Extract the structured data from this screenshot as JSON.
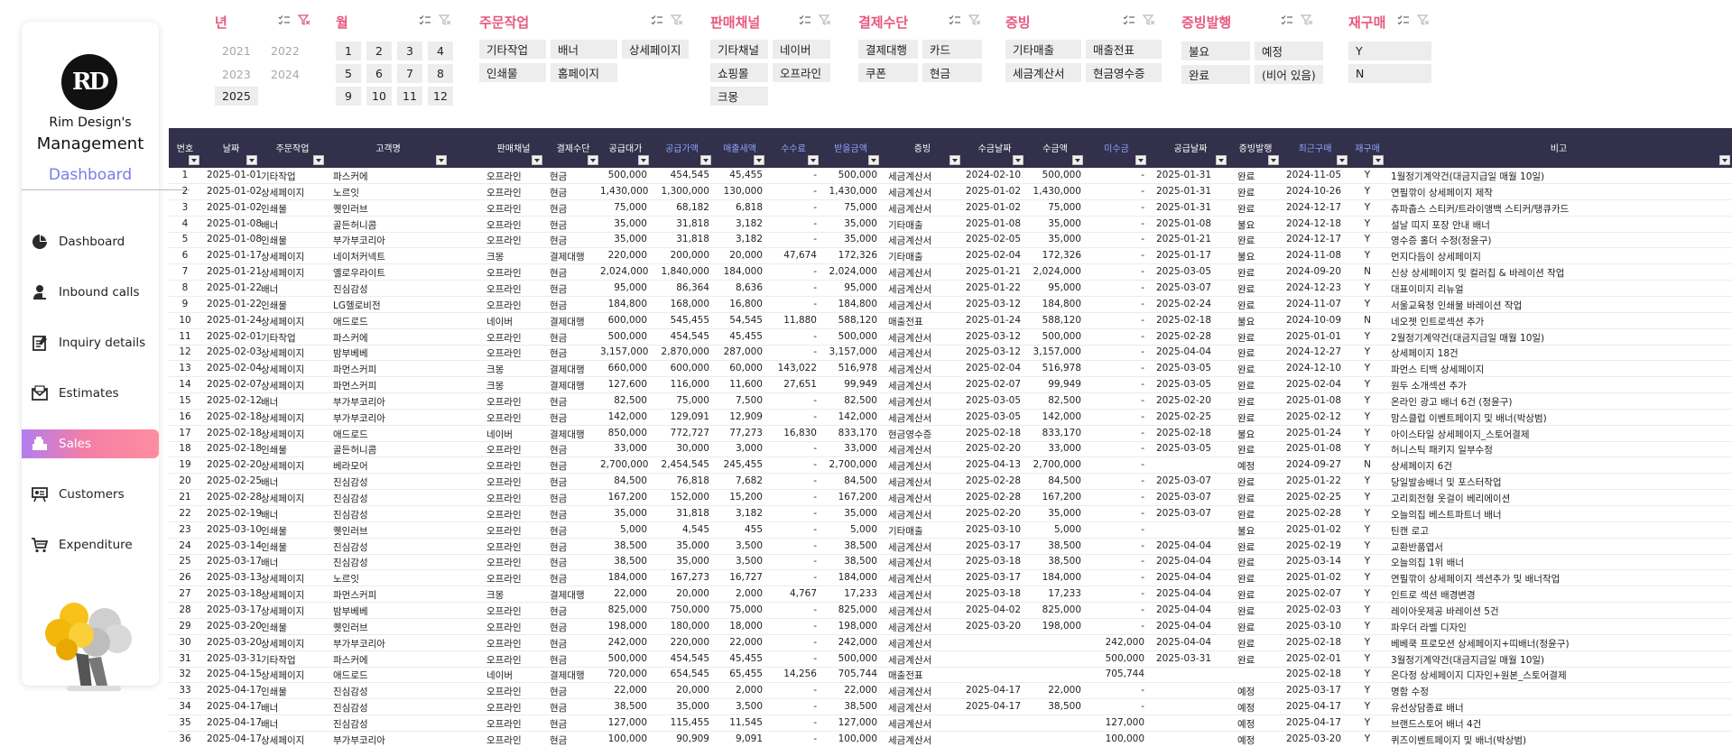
{
  "sidebar": {
    "logo_text": "RD",
    "brand_line1": "Rim Design's",
    "brand_line2": "Management",
    "brand_line3": "Dashboard",
    "nav": [
      {
        "label": "Dashboard",
        "icon": "pie-chart-icon"
      },
      {
        "label": "Inbound calls",
        "icon": "phone-person-icon"
      },
      {
        "label": "Inquiry details",
        "icon": "notepad-icon"
      },
      {
        "label": "Estimates",
        "icon": "envelope-icon"
      },
      {
        "label": "Sales",
        "icon": "cash-register-icon",
        "active": true
      },
      {
        "label": "Customers",
        "icon": "presentation-icon"
      },
      {
        "label": "Expenditure",
        "icon": "cart-icon"
      }
    ]
  },
  "slicers": {
    "year": {
      "title": "년",
      "items": [
        "2021",
        "2022",
        "2023",
        "2024",
        "2025"
      ],
      "selected": [
        "2025"
      ]
    },
    "month": {
      "title": "월",
      "items": [
        "1",
        "2",
        "3",
        "4",
        "5",
        "6",
        "7",
        "8",
        "9",
        "10",
        "11",
        "12"
      ]
    },
    "job": {
      "title": "주문작업",
      "items": [
        "기타작업",
        "배너",
        "상세페이지",
        "인쇄물",
        "홈페이지"
      ]
    },
    "channel": {
      "title": "판매채널",
      "items": [
        "기타채널",
        "네이버",
        "쇼핑몰",
        "오프라인",
        "크몽"
      ]
    },
    "payment": {
      "title": "결제수단",
      "items": [
        "결제대행",
        "카드",
        "쿠폰",
        "현금"
      ]
    },
    "evidence": {
      "title": "증빙",
      "items": [
        "기타매출",
        "매출전표",
        "세금계산서",
        "현금영수증"
      ]
    },
    "evidence_issue": {
      "title": "증빙발행",
      "items": [
        "불요",
        "예정",
        "완료",
        "(비어 있음)"
      ]
    },
    "repurchase": {
      "title": "재구매",
      "items": [
        "Y",
        "N"
      ]
    }
  },
  "table": {
    "headers": [
      "번호",
      "날짜",
      "주문작업",
      "고객명",
      "판매채널",
      "결제수단",
      "공급대가",
      "공급가액",
      "매출세액",
      "수수료",
      "받을금액",
      "증빙",
      "수금날짜",
      "수금액",
      "미수금",
      "공급날짜",
      "증빙발행",
      "최근구매",
      "재구매",
      "비고"
    ],
    "rows": [
      [
        "1",
        "2025-01-01",
        "기타작업",
        "파스커에",
        "오프라인",
        "현금",
        "500,000",
        "454,545",
        "45,455",
        "-",
        "500,000",
        "세금계산서",
        "2024-02-10",
        "500,000",
        "-",
        "2025-01-31",
        "완료",
        "2024-11-05",
        "Y",
        "1월정기계약건(대금지급일 매월 10일)"
      ],
      [
        "2",
        "2025-01-02",
        "상세페이지",
        "노르잇",
        "오프라인",
        "현금",
        "1,430,000",
        "1,300,000",
        "130,000",
        "-",
        "1,430,000",
        "세금계산서",
        "2025-01-02",
        "1,430,000",
        "-",
        "2025-01-31",
        "완료",
        "2024-10-26",
        "Y",
        "연필깎이 상세페이지 제작"
      ],
      [
        "3",
        "2025-01-02",
        "인쇄물",
        "퀫인러브",
        "오프라인",
        "현금",
        "75,000",
        "68,182",
        "6,818",
        "-",
        "75,000",
        "세금계산서",
        "2025-01-02",
        "75,000",
        "-",
        "2025-01-31",
        "완료",
        "2024-12-17",
        "Y",
        "츄파춥스 스티커/트라이앵백 스티커/탱큐카드"
      ],
      [
        "4",
        "2025-01-08",
        "배너",
        "골든허니콤",
        "오프라인",
        "현금",
        "35,000",
        "31,818",
        "3,182",
        "-",
        "35,000",
        "기타매출",
        "2025-01-08",
        "35,000",
        "-",
        "2025-01-08",
        "불요",
        "2024-12-18",
        "Y",
        "설날 띠지 포장 안내 배너"
      ],
      [
        "5",
        "2025-01-08",
        "인쇄물",
        "부가부코리아",
        "오프라인",
        "현금",
        "35,000",
        "31,818",
        "3,182",
        "-",
        "35,000",
        "세금계산서",
        "2025-02-05",
        "35,000",
        "-",
        "2025-01-21",
        "완료",
        "2024-12-17",
        "Y",
        "영수증 홀더 수정(정윤구)"
      ],
      [
        "6",
        "2025-01-17",
        "상세페이지",
        "네이처커넥트",
        "크몽",
        "결제대행",
        "220,000",
        "200,000",
        "20,000",
        "47,674",
        "172,326",
        "기타매출",
        "2025-02-04",
        "172,326",
        "-",
        "2025-01-17",
        "불요",
        "2024-11-08",
        "Y",
        "먼지다듬이 상세페이지"
      ],
      [
        "7",
        "2025-01-21",
        "상세페이지",
        "옐로우라이트",
        "오프라인",
        "현금",
        "2,024,000",
        "1,840,000",
        "184,000",
        "-",
        "2,024,000",
        "세금계산서",
        "2025-01-21",
        "2,024,000",
        "-",
        "2025-03-05",
        "완료",
        "2024-09-20",
        "N",
        "신상 상세페이지 및 컬러칩 & 바레이션 작업"
      ],
      [
        "8",
        "2025-01-22",
        "배너",
        "진심감성",
        "오프라인",
        "현금",
        "95,000",
        "86,364",
        "8,636",
        "-",
        "95,000",
        "세금계산서",
        "2025-01-22",
        "95,000",
        "-",
        "2025-03-07",
        "완료",
        "2024-12-23",
        "Y",
        "대표이미지 리뉴얼"
      ],
      [
        "9",
        "2025-01-22",
        "인쇄물",
        "LG헬로비전",
        "오프라인",
        "현금",
        "184,800",
        "168,000",
        "16,800",
        "-",
        "184,800",
        "세금계산서",
        "2025-03-12",
        "184,800",
        "-",
        "2025-02-24",
        "완료",
        "2024-11-07",
        "Y",
        "서울교육청 인쇄물 바레이션 작업"
      ],
      [
        "10",
        "2025-01-24",
        "상세페이지",
        "애드로드",
        "네이버",
        "결제대행",
        "600,000",
        "545,455",
        "54,545",
        "11,880",
        "588,120",
        "매출전표",
        "2025-01-24",
        "588,120",
        "-",
        "2025-02-18",
        "불요",
        "2024-10-09",
        "N",
        "네오젯 인트로섹션 추가"
      ],
      [
        "11",
        "2025-02-01",
        "기타작업",
        "파스커에",
        "오프라인",
        "현금",
        "500,000",
        "454,545",
        "45,455",
        "-",
        "500,000",
        "세금계산서",
        "2025-03-12",
        "500,000",
        "-",
        "2025-02-28",
        "완료",
        "2025-01-01",
        "Y",
        "2월정기계약건(대금지급일 매월 10일)"
      ],
      [
        "12",
        "2025-02-03",
        "상세페이지",
        "밤부베베",
        "오프라인",
        "현금",
        "3,157,000",
        "2,870,000",
        "287,000",
        "-",
        "3,157,000",
        "세금계산서",
        "2025-03-12",
        "3,157,000",
        "-",
        "2025-04-04",
        "완료",
        "2024-12-27",
        "Y",
        "상세페이지 18건"
      ],
      [
        "13",
        "2025-02-04",
        "상세페이지",
        "파먼스커피",
        "크몽",
        "결제대행",
        "660,000",
        "600,000",
        "60,000",
        "143,022",
        "516,978",
        "세금계산서",
        "2025-02-04",
        "516,978",
        "-",
        "2025-03-05",
        "완료",
        "2024-12-10",
        "Y",
        "파먼스 티백 상세페이지"
      ],
      [
        "14",
        "2025-02-07",
        "상세페이지",
        "파먼스커피",
        "크몽",
        "결제대행",
        "127,600",
        "116,000",
        "11,600",
        "27,651",
        "99,949",
        "세금계산서",
        "2025-02-07",
        "99,949",
        "-",
        "2025-03-05",
        "완료",
        "2025-02-04",
        "Y",
        "원두 소개섹션 추가"
      ],
      [
        "15",
        "2025-02-12",
        "배너",
        "부가부코리아",
        "오프라인",
        "현금",
        "82,500",
        "75,000",
        "7,500",
        "-",
        "82,500",
        "세금계산서",
        "2025-03-05",
        "82,500",
        "-",
        "2025-02-20",
        "완료",
        "2025-01-08",
        "Y",
        "온라인 광고 배너 6건 (정윤구)"
      ],
      [
        "16",
        "2025-02-18",
        "상세페이지",
        "부가부코리아",
        "오프라인",
        "현금",
        "142,000",
        "129,091",
        "12,909",
        "-",
        "142,000",
        "세금계산서",
        "2025-03-05",
        "142,000",
        "-",
        "2025-02-25",
        "완료",
        "2025-02-12",
        "Y",
        "맘스클럽 이벤트페이지 및 배너(박상범)"
      ],
      [
        "17",
        "2025-02-18",
        "상세페이지",
        "애드로드",
        "네이버",
        "결제대행",
        "850,000",
        "772,727",
        "77,273",
        "16,830",
        "833,170",
        "현금영수증",
        "2025-02-18",
        "833,170",
        "-",
        "2025-02-18",
        "불요",
        "2025-01-24",
        "Y",
        "아이스타일 상세페이지_스토어결제"
      ],
      [
        "18",
        "2025-02-18",
        "인쇄물",
        "골든허니콤",
        "오프라인",
        "현금",
        "33,000",
        "30,000",
        "3,000",
        "-",
        "33,000",
        "세금계산서",
        "2025-02-20",
        "33,000",
        "-",
        "2025-03-05",
        "완료",
        "2025-01-08",
        "Y",
        "허니스틱 패키지 일부수정"
      ],
      [
        "19",
        "2025-02-20",
        "상세페이지",
        "베라모어",
        "오프라인",
        "현금",
        "2,700,000",
        "2,454,545",
        "245,455",
        "-",
        "2,700,000",
        "세금계산서",
        "2025-04-13",
        "2,700,000",
        "-",
        "",
        "예정",
        "2024-09-27",
        "N",
        "상세페이지 6건"
      ],
      [
        "20",
        "2025-02-25",
        "배너",
        "진심감성",
        "오프라인",
        "현금",
        "84,500",
        "76,818",
        "7,682",
        "-",
        "84,500",
        "세금계산서",
        "2025-02-28",
        "84,500",
        "-",
        "2025-03-07",
        "완료",
        "2025-01-22",
        "Y",
        "당일발송배너 및 포스터작업"
      ],
      [
        "21",
        "2025-02-28",
        "상세페이지",
        "진심감성",
        "오프라인",
        "현금",
        "167,200",
        "152,000",
        "15,200",
        "-",
        "167,200",
        "세금계산서",
        "2025-02-28",
        "167,200",
        "-",
        "2025-03-07",
        "완료",
        "2025-02-25",
        "Y",
        "고리회전형 옷걸이 베리에이션"
      ],
      [
        "22",
        "2025-02-19",
        "배너",
        "진심감성",
        "오프라인",
        "현금",
        "35,000",
        "31,818",
        "3,182",
        "-",
        "35,000",
        "세금계산서",
        "2025-02-20",
        "35,000",
        "-",
        "2025-03-07",
        "완료",
        "2025-02-28",
        "Y",
        "오늘의집 베스트파트너 배너"
      ],
      [
        "23",
        "2025-03-10",
        "인쇄물",
        "퀫인러브",
        "오프라인",
        "현금",
        "5,000",
        "4,545",
        "455",
        "-",
        "5,000",
        "기타매출",
        "2025-03-10",
        "5,000",
        "-",
        "",
        "불요",
        "2025-01-02",
        "Y",
        "틴캔 로고"
      ],
      [
        "24",
        "2025-03-14",
        "인쇄물",
        "진심감성",
        "오프라인",
        "현금",
        "38,500",
        "35,000",
        "3,500",
        "-",
        "38,500",
        "세금계산서",
        "2025-03-17",
        "38,500",
        "-",
        "2025-04-04",
        "완료",
        "2025-02-19",
        "Y",
        "교환반품엽서"
      ],
      [
        "25",
        "2025-03-17",
        "배너",
        "진심감성",
        "오프라인",
        "현금",
        "38,500",
        "35,000",
        "3,500",
        "-",
        "38,500",
        "세금계산서",
        "2025-03-18",
        "38,500",
        "-",
        "2025-04-04",
        "완료",
        "2025-03-14",
        "Y",
        "오늘의집 1위 배너"
      ],
      [
        "26",
        "2025-03-13",
        "상세페이지",
        "노르잇",
        "오프라인",
        "현금",
        "184,000",
        "167,273",
        "16,727",
        "-",
        "184,000",
        "세금계산서",
        "2025-03-17",
        "184,000",
        "-",
        "2025-04-04",
        "완료",
        "2025-01-02",
        "Y",
        "연필깎이 상세페이지 섹션추가 및 배너작업"
      ],
      [
        "27",
        "2025-03-18",
        "상세페이지",
        "파먼스커피",
        "크몽",
        "결제대행",
        "22,000",
        "20,000",
        "2,000",
        "4,767",
        "17,233",
        "세금계산서",
        "2025-03-18",
        "17,233",
        "-",
        "2025-04-04",
        "완료",
        "2025-02-07",
        "Y",
        "인트로 섹션 배경변경"
      ],
      [
        "28",
        "2025-03-17",
        "상세페이지",
        "밤부베베",
        "오프라인",
        "현금",
        "825,000",
        "750,000",
        "75,000",
        "-",
        "825,000",
        "세금계산서",
        "2025-04-02",
        "825,000",
        "-",
        "2025-04-04",
        "완료",
        "2025-02-03",
        "Y",
        "레이아웃제공 바레이션 5건"
      ],
      [
        "29",
        "2025-03-20",
        "인쇄물",
        "퀫인러브",
        "오프라인",
        "현금",
        "198,000",
        "180,000",
        "18,000",
        "-",
        "198,000",
        "세금계산서",
        "2025-03-20",
        "198,000",
        "-",
        "2025-04-04",
        "완료",
        "2025-03-10",
        "Y",
        "파우더 라벨 디자인"
      ],
      [
        "30",
        "2025-03-20",
        "상세페이지",
        "부가부코리아",
        "오프라인",
        "현금",
        "242,000",
        "220,000",
        "22,000",
        "-",
        "242,000",
        "세금계산서",
        "",
        "",
        "242,000",
        "2025-04-04",
        "완료",
        "2025-02-18",
        "Y",
        "베베쿡 프로모션 상세페이지+띠배너(정윤구)"
      ],
      [
        "31",
        "2025-03-31",
        "기타작업",
        "파스커에",
        "오프라인",
        "현금",
        "500,000",
        "454,545",
        "45,455",
        "-",
        "500,000",
        "세금계산서",
        "",
        "",
        "500,000",
        "2025-03-31",
        "완료",
        "2025-02-01",
        "Y",
        "3월정기계약건(대금지급일 매월 10일)"
      ],
      [
        "32",
        "2025-04-15",
        "상세페이지",
        "애드로드",
        "네이버",
        "결제대행",
        "720,000",
        "654,545",
        "65,455",
        "14,256",
        "705,744",
        "매출전표",
        "",
        "",
        "705,744",
        "",
        "",
        "2025-02-18",
        "Y",
        "온다정 상세페이지 디자인+원본_스토어결제"
      ],
      [
        "33",
        "2025-04-17",
        "인쇄물",
        "진심감성",
        "오프라인",
        "현금",
        "22,000",
        "20,000",
        "2,000",
        "-",
        "22,000",
        "세금계산서",
        "2025-04-17",
        "22,000",
        "-",
        "",
        "예정",
        "2025-03-17",
        "Y",
        "명함 수정"
      ],
      [
        "34",
        "2025-04-17",
        "배너",
        "진심감성",
        "오프라인",
        "현금",
        "38,500",
        "35,000",
        "3,500",
        "-",
        "38,500",
        "세금계산서",
        "2025-04-17",
        "38,500",
        "-",
        "",
        "예정",
        "2025-04-17",
        "Y",
        "유선상담종료 배너"
      ],
      [
        "35",
        "2025-04-17",
        "배너",
        "진심감성",
        "오프라인",
        "현금",
        "127,000",
        "115,455",
        "11,545",
        "-",
        "127,000",
        "세금계산서",
        "",
        "",
        "127,000",
        "",
        "예정",
        "2025-04-17",
        "Y",
        "브랜드스토어 배너 4건"
      ],
      [
        "36",
        "2025-04-17",
        "상세페이지",
        "부가부코리아",
        "오프라인",
        "현금",
        "100,000",
        "90,909",
        "9,091",
        "-",
        "100,000",
        "세금계산서",
        "",
        "",
        "100,000",
        "",
        "예정",
        "2025-03-20",
        "Y",
        "퀴즈이벤트페이지 및 배너(박상범)"
      ]
    ]
  },
  "colors": {
    "accent_pink": "#e8577e",
    "header_bg": "#32304a",
    "header_blue": "#8ea4ff",
    "dashboard_purple": "#7a7be8"
  }
}
